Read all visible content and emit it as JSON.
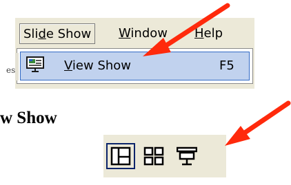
{
  "menu": {
    "items": [
      {
        "before": "Sli",
        "under": "d",
        "after": "e Show",
        "state": "active"
      },
      {
        "before": "",
        "under": "W",
        "after": "indow",
        "state": "normal"
      },
      {
        "before": "",
        "under": "H",
        "after": "elp",
        "state": "normal"
      }
    ],
    "dropdown": {
      "item": {
        "icon": "slide-show-screen-icon",
        "label_underlined": "V",
        "label_rest": "iew Show",
        "shortcut": "F5",
        "state": "highlighted"
      }
    },
    "edge_text": "es"
  },
  "heading": "w Show",
  "view_buttons": {
    "items": [
      {
        "icon": "normal-view-icon",
        "state": "selected"
      },
      {
        "icon": "slide-sorter-view-icon",
        "state": "normal"
      },
      {
        "icon": "slide-show-view-icon",
        "state": "normal"
      }
    ]
  },
  "annotations": {
    "arrow_color": "#ff2a0c",
    "count": 2
  },
  "colors": {
    "menu_background": "#ece9d8",
    "highlight_fill": "#c1d2ee",
    "highlight_border": "#316ac5",
    "selected_button_border": "#0a246a"
  }
}
